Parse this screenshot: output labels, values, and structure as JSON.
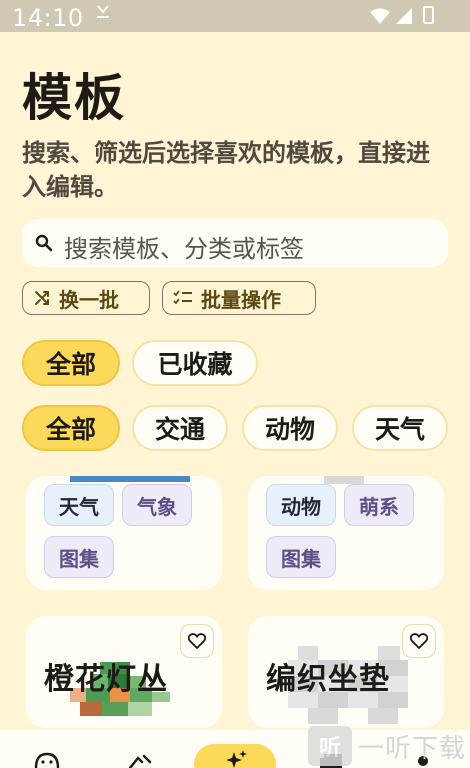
{
  "status": {
    "time": "14:10"
  },
  "header": {
    "title": "模板",
    "subtitle": "搜索、筛选后选择喜欢的模板，直接进入编辑。"
  },
  "search": {
    "placeholder": "搜索模板、分类或标签"
  },
  "actions": {
    "shuffle_label": "换一批",
    "batch_label": "批量操作"
  },
  "scope_filters": [
    {
      "label": "全部",
      "selected": true
    },
    {
      "label": "已收藏",
      "selected": false
    }
  ],
  "category_filters": [
    {
      "label": "全部",
      "selected": true
    },
    {
      "label": "交通",
      "selected": false
    },
    {
      "label": "动物",
      "selected": false
    },
    {
      "label": "天气",
      "selected": false
    }
  ],
  "cards_row1": [
    {
      "tags": [
        "天气",
        "气象",
        "图集"
      ]
    },
    {
      "tags": [
        "动物",
        "萌系",
        "图集"
      ]
    }
  ],
  "cards_row2": [
    {
      "title": "橙花灯丛"
    },
    {
      "title": "编织坐垫"
    }
  ],
  "watermark": {
    "logo": "听",
    "text": "一听下载"
  },
  "colors": {
    "background": "#FFF5D4",
    "accent": "#FCD95B",
    "tag_blue": "#E6F1FC",
    "tag_purple": "#EFEAF8"
  },
  "icons": [
    "search-icon",
    "shuffle-icon",
    "checklist-icon",
    "heart-icon",
    "smile-icon",
    "brush-icon",
    "sparkle-icon",
    "gallery-icon"
  ]
}
